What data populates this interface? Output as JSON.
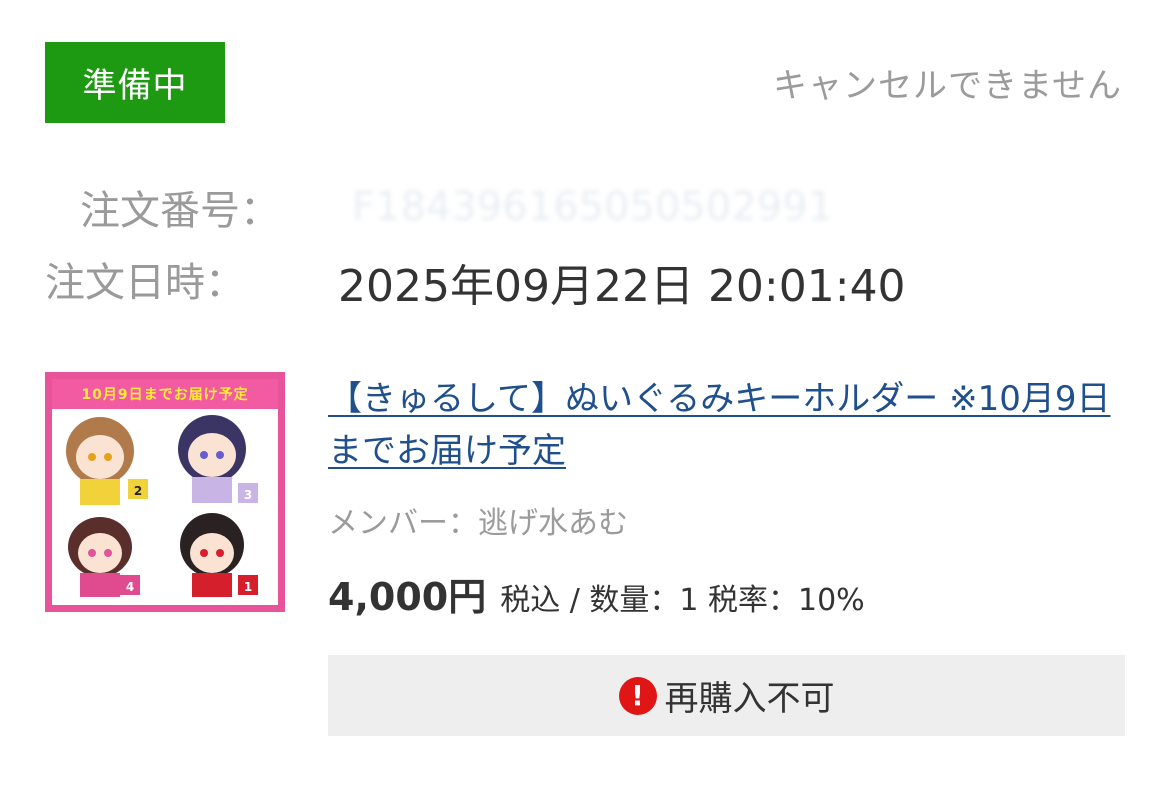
{
  "status": {
    "label": "準備中"
  },
  "cancel_note": "キャンセルできません",
  "order": {
    "number_label": "注文番号：",
    "number_value": "F184396165050502991",
    "date_label": "注文日時：",
    "date_value": "2025年09月22日 20:01:40"
  },
  "product": {
    "image_banner": "10月9日までお届け予定",
    "title": "【きゅるして】ぬいぐるみキーホルダー ※10月9日までお届け予定",
    "member_label": "メンバー：",
    "member_value": "逃げ水あむ",
    "price": "4,000円",
    "price_meta": "税込 / 数量：1 税率：10%"
  },
  "rebuy": {
    "icon": "alert-circle-icon",
    "label": "再購入不可"
  },
  "colors": {
    "status_green": "#1e9a12",
    "link_blue": "#1f4f8c",
    "alert_red": "#e01616",
    "thumb_pink": "#e8549a"
  }
}
